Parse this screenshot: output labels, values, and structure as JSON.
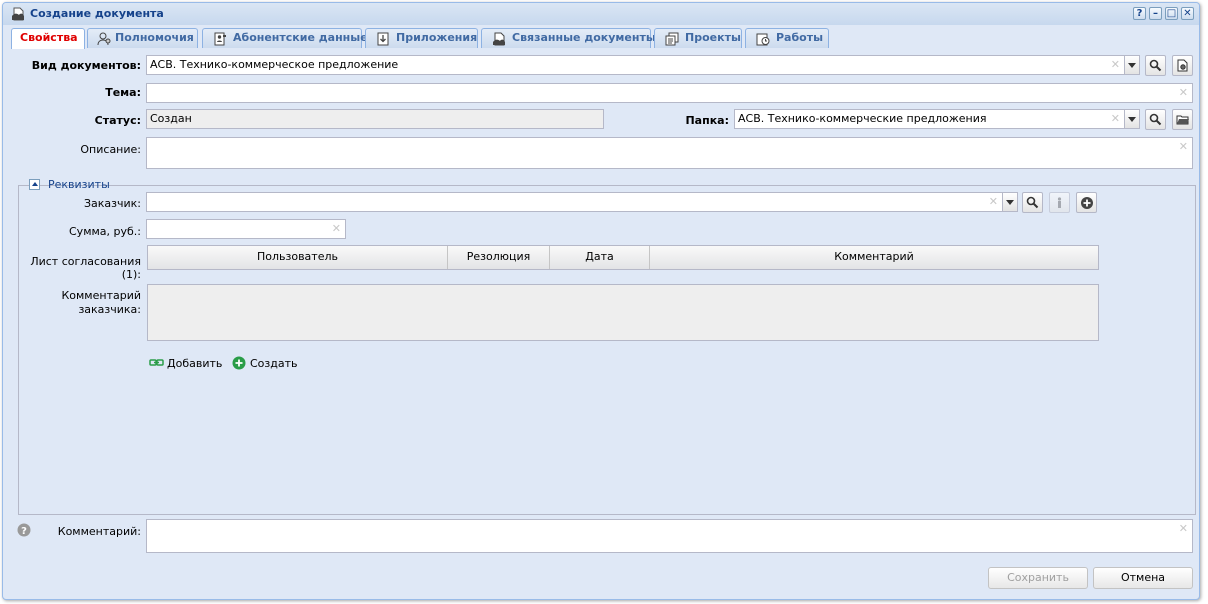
{
  "window": {
    "title": "Создание документа",
    "tools": [
      "?",
      "–",
      "□",
      "✕"
    ]
  },
  "tabs": [
    {
      "label": "Свойства",
      "icon": "none",
      "active": true
    },
    {
      "label": "Полномочия",
      "icon": "user-key-icon"
    },
    {
      "label": "Абонентские данные",
      "icon": "contact-card-icon"
    },
    {
      "label": "Приложения",
      "icon": "attachment-download-icon"
    },
    {
      "label": "Связанные документы",
      "icon": "linked-documents-icon"
    },
    {
      "label": "Проекты",
      "icon": "projects-icon"
    },
    {
      "label": "Работы",
      "icon": "tasks-clock-icon"
    }
  ],
  "form": {
    "doc_type_label": "Вид документов:",
    "doc_type_value": "АСВ. Технико-коммерческое предложение",
    "subject_label": "Тема:",
    "subject_value": "",
    "status_label": "Статус:",
    "status_value": "Создан",
    "folder_label": "Папка:",
    "folder_value": "АСВ. Технико-коммерческие предложения",
    "description_label": "Описание:",
    "description_value": ""
  },
  "requisites": {
    "legend": "Реквизиты",
    "customer_label": "Заказчик:",
    "customer_value": "",
    "sum_label": "Сумма, руб.:",
    "sum_value": "",
    "approval_label_line1": "Лист согласования",
    "approval_label_line2": "(1):",
    "approval_columns": [
      "Пользователь",
      "Резолюция",
      "Дата",
      "Комментарий"
    ],
    "customer_comment_label_line1": "Комментарий",
    "customer_comment_label_line2": "заказчика:",
    "add_label": "Добавить",
    "create_label": "Создать"
  },
  "footer": {
    "comment_label": "Комментарий:",
    "comment_value": "",
    "save_label": "Сохранить",
    "cancel_label": "Отмена"
  },
  "colors": {
    "accent": "#15428b",
    "active_tab_text": "#e00000",
    "panel_bg": "#dfe8f6",
    "create_green": "#2a9d48"
  }
}
